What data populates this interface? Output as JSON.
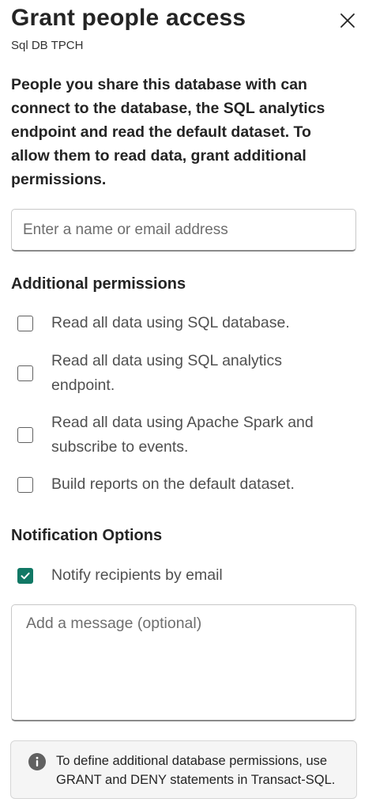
{
  "header": {
    "title": "Grant people access",
    "subtitle": "Sql DB TPCH"
  },
  "description": "People you share this database with can connect to the database, the SQL analytics endpoint and read the default dataset. To allow them to read data, grant additional permissions.",
  "name_input": {
    "placeholder": "Enter a name or email address",
    "value": ""
  },
  "additional_permissions": {
    "title": "Additional permissions",
    "items": [
      {
        "label": "Read all data using SQL database.",
        "checked": false
      },
      {
        "label": "Read all data using SQL analytics endpoint.",
        "checked": false
      },
      {
        "label": "Read all data using Apache Spark and subscribe to events.",
        "checked": false
      },
      {
        "label": "Build reports on the default dataset.",
        "checked": false
      }
    ]
  },
  "notification": {
    "title": "Notification Options",
    "notify_label": "Notify recipients by email",
    "notify_checked": true,
    "message_placeholder": "Add a message (optional)",
    "message_value": ""
  },
  "info": {
    "text": "To define additional database permissions, use GRANT and DENY statements in Transact-SQL."
  },
  "colors": {
    "accent": "#117865",
    "info_icon": "#616161"
  },
  "icons": {
    "close": "close-icon",
    "info": "info-icon",
    "check": "checkmark-icon"
  }
}
